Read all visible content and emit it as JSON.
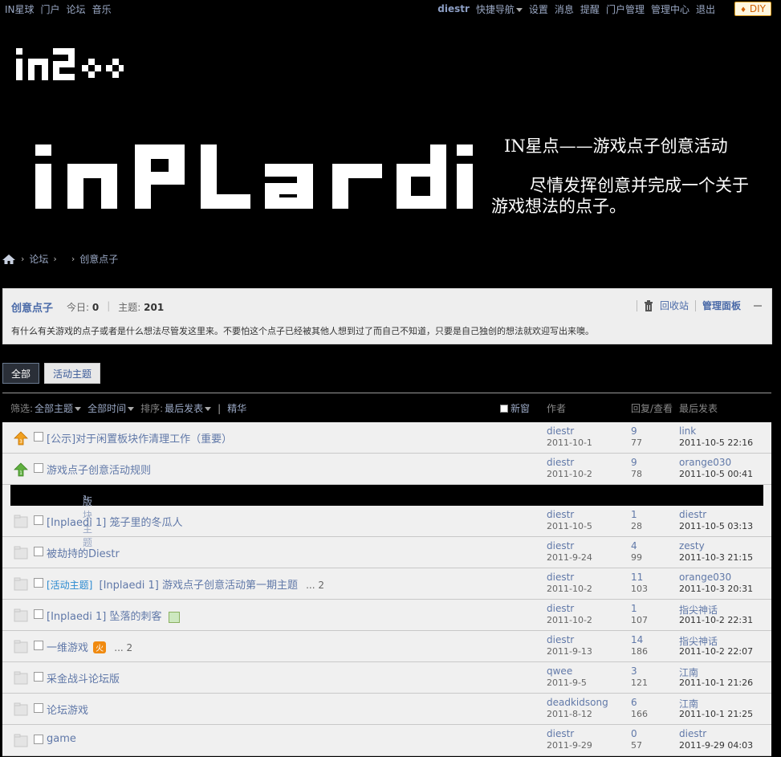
{
  "topbar": {
    "left_links": [
      "IN星球",
      "门户",
      "论坛",
      "音乐"
    ],
    "user": "diestr",
    "quick_nav": "快捷导航",
    "right_links": [
      "设置",
      "消息",
      "提醒",
      "门户管理",
      "管理中心",
      "退出"
    ],
    "diy": "DIY"
  },
  "banner": {
    "title": "IN星点——游戏点子创意活动",
    "description": "尽情发挥创意并完成一个关于游戏想法的点子。"
  },
  "breadcrumb": {
    "items": [
      "论坛",
      "创意点子"
    ]
  },
  "forum": {
    "name": "创意点子",
    "today_label": "今日:",
    "today_value": "0",
    "topics_label": "主题:",
    "topics_value": "201",
    "recycle": "回收站",
    "admin_panel": "管理面板",
    "description": "有什么有关游戏的点子或者是什么想法尽管发这里来。不要怕这个点子已经被其他人想到过了而自己不知道，只要是自己独创的想法就欢迎写出来噢。"
  },
  "tabs": [
    "全部",
    "活动主题"
  ],
  "filter": {
    "label": "筛选:",
    "all_topics": "全部主题",
    "all_time": "全部时间",
    "sort_label": "排序:",
    "sort_value": "最后发表",
    "digest": "精华",
    "new_window": "新窗",
    "col_author": "作者",
    "col_replies": "回复/查看",
    "col_last": "最后发表"
  },
  "sticky_threads": [
    {
      "title": "[公示]对于闲置板块作清理工作（重要）",
      "author": "diestr",
      "date": "2011-10-1",
      "replies": "9",
      "views": "77",
      "last_user": "link",
      "last_date": "2011-10-5 22:16"
    },
    {
      "title": "游戏点子创意活动规则",
      "author": "diestr",
      "date": "2011-10-2",
      "replies": "9",
      "views": "78",
      "last_user": "orange030",
      "last_date": "2011-10-5 00:41"
    }
  ],
  "section_label": "版块主题",
  "threads": [
    {
      "tag": "",
      "title": "[Inplaedi 1] 笼子里的冬瓜人",
      "suffix": "",
      "author": "diestr",
      "date": "2011-10-5",
      "replies": "1",
      "views": "28",
      "last_user": "diestr",
      "last_date": "2011-10-5 03:13"
    },
    {
      "tag": "",
      "title": "被劫持的Diestr",
      "suffix": "",
      "author": "diestr",
      "date": "2011-9-24",
      "replies": "4",
      "views": "99",
      "last_user": "zesty",
      "last_date": "2011-10-3 21:15"
    },
    {
      "tag": "[活动主题]",
      "title": "[Inplaedi 1] 游戏点子创意活动第一期主题",
      "suffix": "... 2",
      "author": "diestr",
      "date": "2011-10-2",
      "replies": "11",
      "views": "103",
      "last_user": "orange030",
      "last_date": "2011-10-3 20:31"
    },
    {
      "tag": "",
      "title": "[Inplaedi 1] 坠落的刺客",
      "suffix": "",
      "author": "diestr",
      "date": "2011-10-2",
      "replies": "1",
      "views": "107",
      "last_user": "指尖神话",
      "last_date": "2011-10-2 22:31"
    },
    {
      "tag": "",
      "title": "一维游戏",
      "suffix": "... 2",
      "author": "diestr",
      "date": "2011-9-13",
      "replies": "14",
      "views": "186",
      "last_user": "指尖神话",
      "last_date": "2011-10-2 22:07"
    },
    {
      "tag": "",
      "title": "采金战斗论坛版",
      "suffix": "",
      "author": "qwee",
      "date": "2011-9-5",
      "replies": "3",
      "views": "121",
      "last_user": "江南",
      "last_date": "2011-10-1 21:26"
    },
    {
      "tag": "",
      "title": "论坛游戏",
      "suffix": "",
      "author": "deadkidsong",
      "date": "2011-8-12",
      "replies": "6",
      "views": "166",
      "last_user": "江南",
      "last_date": "2011-10-1 21:25"
    },
    {
      "tag": "",
      "title": "game",
      "suffix": "",
      "author": "diestr",
      "date": "2011-9-29",
      "replies": "0",
      "views": "57",
      "last_user": "diestr",
      "last_date": "2011-9-29 04:03"
    }
  ],
  "hot_badge": "火",
  "colors": {
    "accent": "#4a6aa8",
    "link": "#6078a8",
    "bg": "#000000",
    "list_bg": "#f0f0f0"
  }
}
